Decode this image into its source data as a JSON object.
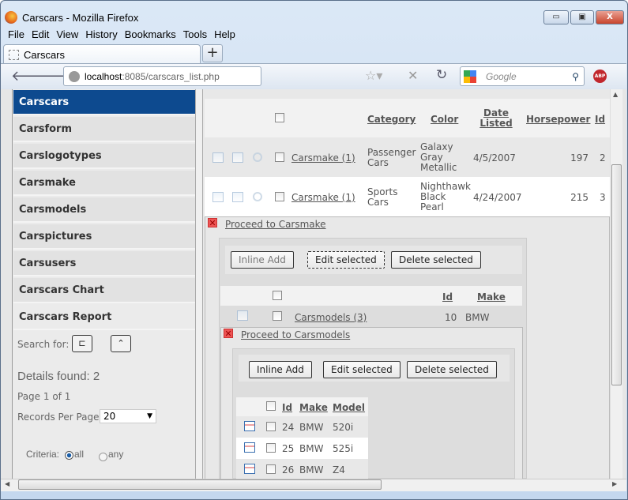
{
  "window": {
    "title": "Carscars - Mozilla Firefox",
    "controls": [
      "minimize",
      "maximize",
      "close"
    ]
  },
  "menu": [
    "File",
    "Edit",
    "View",
    "History",
    "Bookmarks",
    "Tools",
    "Help"
  ],
  "tab": {
    "label": "Carscars",
    "new_tab": "+"
  },
  "nav": {
    "url_host": "localhost",
    "url_path": ":8085/carscars_list.php",
    "search_placeholder": "Google",
    "abp": "ABP"
  },
  "sidebar": {
    "items": [
      "Carscars",
      "Carsform",
      "Carslogotypes",
      "Carsmake",
      "Carsmodels",
      "Carspictures",
      "Carsusers",
      "Carscars Chart",
      "Carscars Report"
    ],
    "active": "Carscars",
    "search_label": "Search for:",
    "details_found": "Details found: 2",
    "page_info": "Page 1 of 1",
    "records_label": "Records Per Page:",
    "records_value": "20",
    "criteria_label": "Criteria:",
    "criteria_all": "all",
    "criteria_any": "any",
    "criteria_selected": "all"
  },
  "main_table": {
    "headers": [
      "Category",
      "Color",
      "Date Listed",
      "Horsepower",
      "Id"
    ],
    "rows": [
      {
        "link": "Carsmake (1)",
        "category": "Passenger Cars",
        "color": "Galaxy Gray Metallic",
        "date": "4/5/2007",
        "hp": "197",
        "id": "2"
      },
      {
        "link": "Carsmake (1)",
        "category": "Sports Cars",
        "color": "Nighthawk Black Pearl",
        "date": "4/24/2007",
        "hp": "215",
        "id": "3"
      }
    ]
  },
  "carsmake": {
    "proceed": "Proceed to Carsmake",
    "buttons": [
      "Inline Add",
      "Edit selected",
      "Delete selected"
    ],
    "headers": [
      "Id",
      "Make"
    ],
    "row": {
      "link": "Carsmodels (3)",
      "id": "10",
      "make": "BMW"
    }
  },
  "carsmodels": {
    "proceed": "Proceed to Carsmodels",
    "buttons": [
      "Inline Add",
      "Edit selected",
      "Delete selected"
    ],
    "headers": [
      "Id",
      "Make",
      "Model"
    ],
    "rows": [
      {
        "id": "24",
        "make": "BMW",
        "model": "520i"
      },
      {
        "id": "25",
        "make": "BMW",
        "model": "525i"
      },
      {
        "id": "26",
        "make": "BMW",
        "model": "Z4"
      }
    ]
  }
}
